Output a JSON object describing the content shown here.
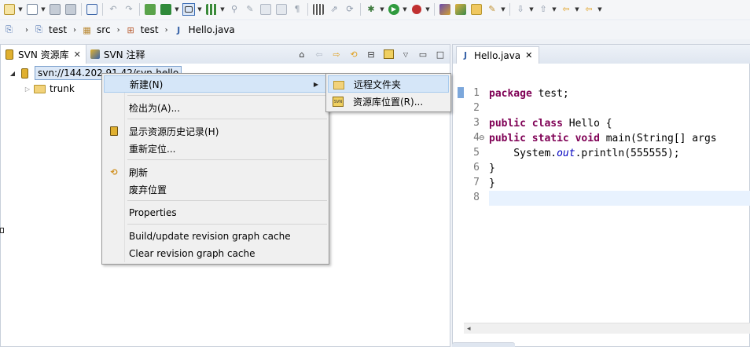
{
  "toolbar": {
    "icons": [
      "new-icon",
      "new-wizard-icon",
      "save-icon",
      "save-all-icon",
      "print-icon",
      "undo-icon",
      "redo-icon",
      "build-icon",
      "deploy-icon",
      "select-mode-icon",
      "grid-icon",
      "pin-icon",
      "tool-icon",
      "tool-icon",
      "tool-icon",
      "tool-icon",
      "tool-icon",
      "tool-icon",
      "tool-icon",
      "debug-icon",
      "run-icon",
      "external-tools-icon",
      "open-type-icon",
      "open-task-icon",
      "open-folder-icon",
      "pen-icon",
      "next-annotation-icon",
      "prev-annotation-icon",
      "back-icon",
      "forward-icon"
    ]
  },
  "breadcrumb": {
    "items": [
      {
        "label": "test",
        "icon": "project-icon"
      },
      {
        "label": "src",
        "icon": "source-folder-icon"
      },
      {
        "label": "test",
        "icon": "package-icon"
      },
      {
        "label": "Hello.java",
        "icon": "java-file-icon"
      }
    ]
  },
  "left_panel": {
    "tabs": [
      {
        "label": "SVN 资源库",
        "active": true,
        "close": "✕"
      },
      {
        "label": "SVN 注释",
        "active": false
      }
    ],
    "tree": {
      "root": "svn://144.202.91.42/svn-hello",
      "children": [
        "trunk"
      ]
    }
  },
  "context_menu": {
    "items": [
      {
        "label": "新建(N)",
        "has_submenu": true,
        "highlighted": true
      },
      {
        "label": "检出为(A)..."
      },
      {
        "label": "显示资源历史记录(H)",
        "icon": "history-icon"
      },
      {
        "label": "重新定位..."
      },
      {
        "label": "刷新",
        "icon": "refresh-icon"
      },
      {
        "label": "废弃位置"
      },
      {
        "label": "Properties"
      },
      {
        "label": "Build/update revision graph cache"
      },
      {
        "label": "Clear revision graph cache"
      }
    ]
  },
  "submenu": {
    "items": [
      {
        "label": "远程文件夹",
        "icon": "folder-icon",
        "highlighted": true
      },
      {
        "label": "资源库位置(R)...",
        "icon": "svn-repository-icon"
      }
    ]
  },
  "editor": {
    "tab": {
      "label": "Hello.java",
      "close": "✕"
    },
    "line_numbers": [
      "1",
      "2",
      "3",
      "4",
      "5",
      "6",
      "7",
      "8"
    ],
    "lines": [
      {
        "kw": "package",
        "rest": " test;"
      },
      {
        "text": ""
      },
      {
        "kw1": "public",
        "kw2": "class",
        "rest": " Hello {"
      },
      {
        "kw1": "public",
        "kw2": "static",
        "kw3": "void",
        "rest": " main(String[] args"
      },
      {
        "pre": "    System.",
        "ital": "out",
        "post": ".println(555555);"
      },
      {
        "text": "}"
      },
      {
        "text": "}"
      },
      {
        "text": ""
      }
    ]
  },
  "colors": {
    "keyword": "#7f0055",
    "field": "#0000c0",
    "selection": "#d5e6f8",
    "current_line": "#e8f2fe"
  }
}
